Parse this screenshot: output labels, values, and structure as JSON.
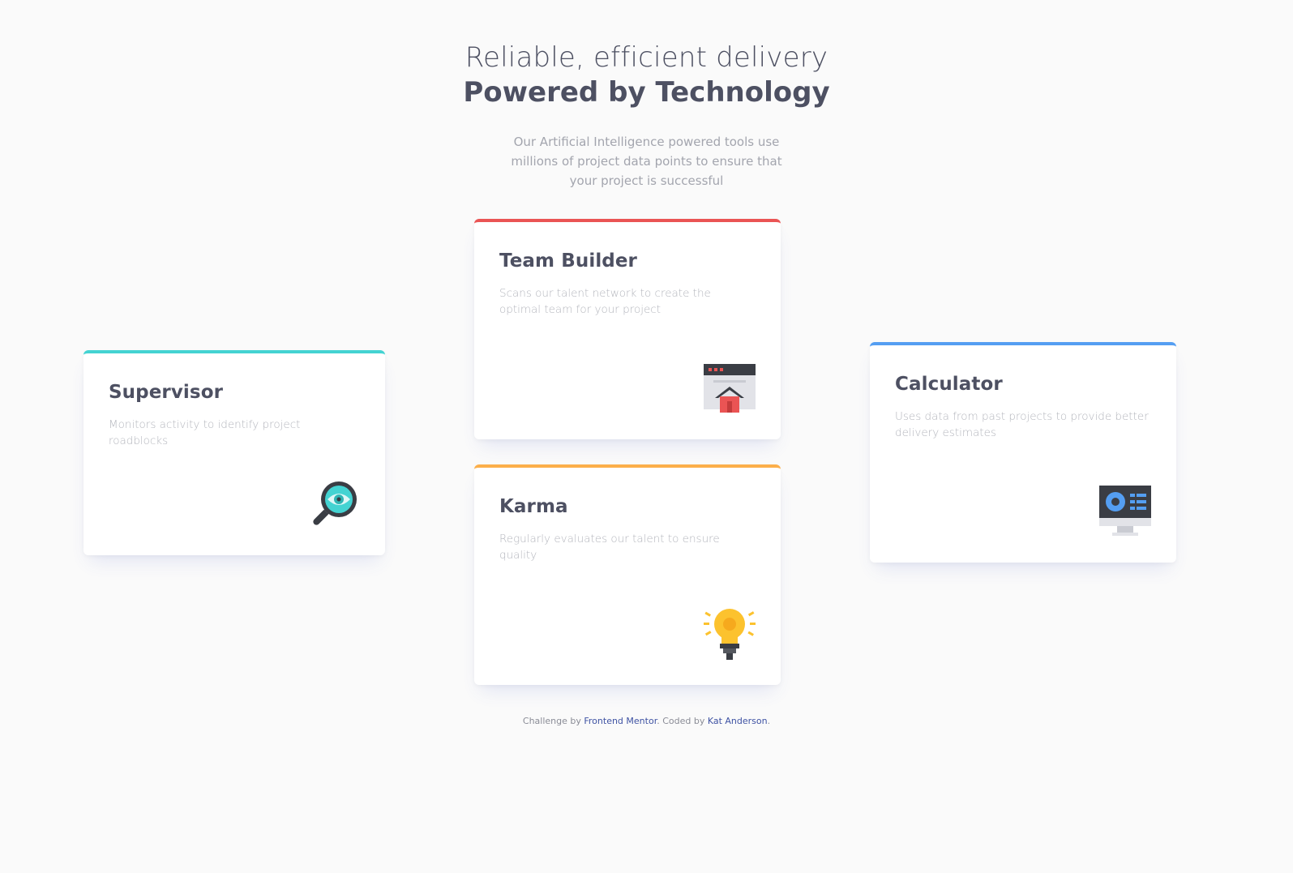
{
  "header": {
    "title_light": "Reliable, efficient delivery",
    "title_bold": "Powered by Technology",
    "intro": "Our Artificial Intelligence powered tools use millions of project data points to ensure that your project is successful"
  },
  "cards": {
    "supervisor": {
      "title": "Supervisor",
      "text": "Monitors activity to identify project roadblocks",
      "accent": "#44d3d2",
      "icon": "magnifier-eye-icon"
    },
    "team_builder": {
      "title": "Team Builder",
      "text": "Scans our talent network to create the optimal team for your project",
      "accent": "#ea5454",
      "icon": "browser-home-icon"
    },
    "karma": {
      "title": "Karma",
      "text": "Regularly evaluates our talent to ensure quality",
      "accent": "#fcaf4a",
      "icon": "lightbulb-icon"
    },
    "calculator": {
      "title": "Calculator",
      "text": "Uses data from past projects to provide better delivery estimates",
      "accent": "#549ef2",
      "icon": "monitor-dashboard-icon"
    }
  },
  "attribution": {
    "prefix": "Challenge by",
    "link1": "Frontend Mentor",
    "middle": ". Coded by",
    "link2": "Kat Anderson",
    "suffix": "."
  }
}
